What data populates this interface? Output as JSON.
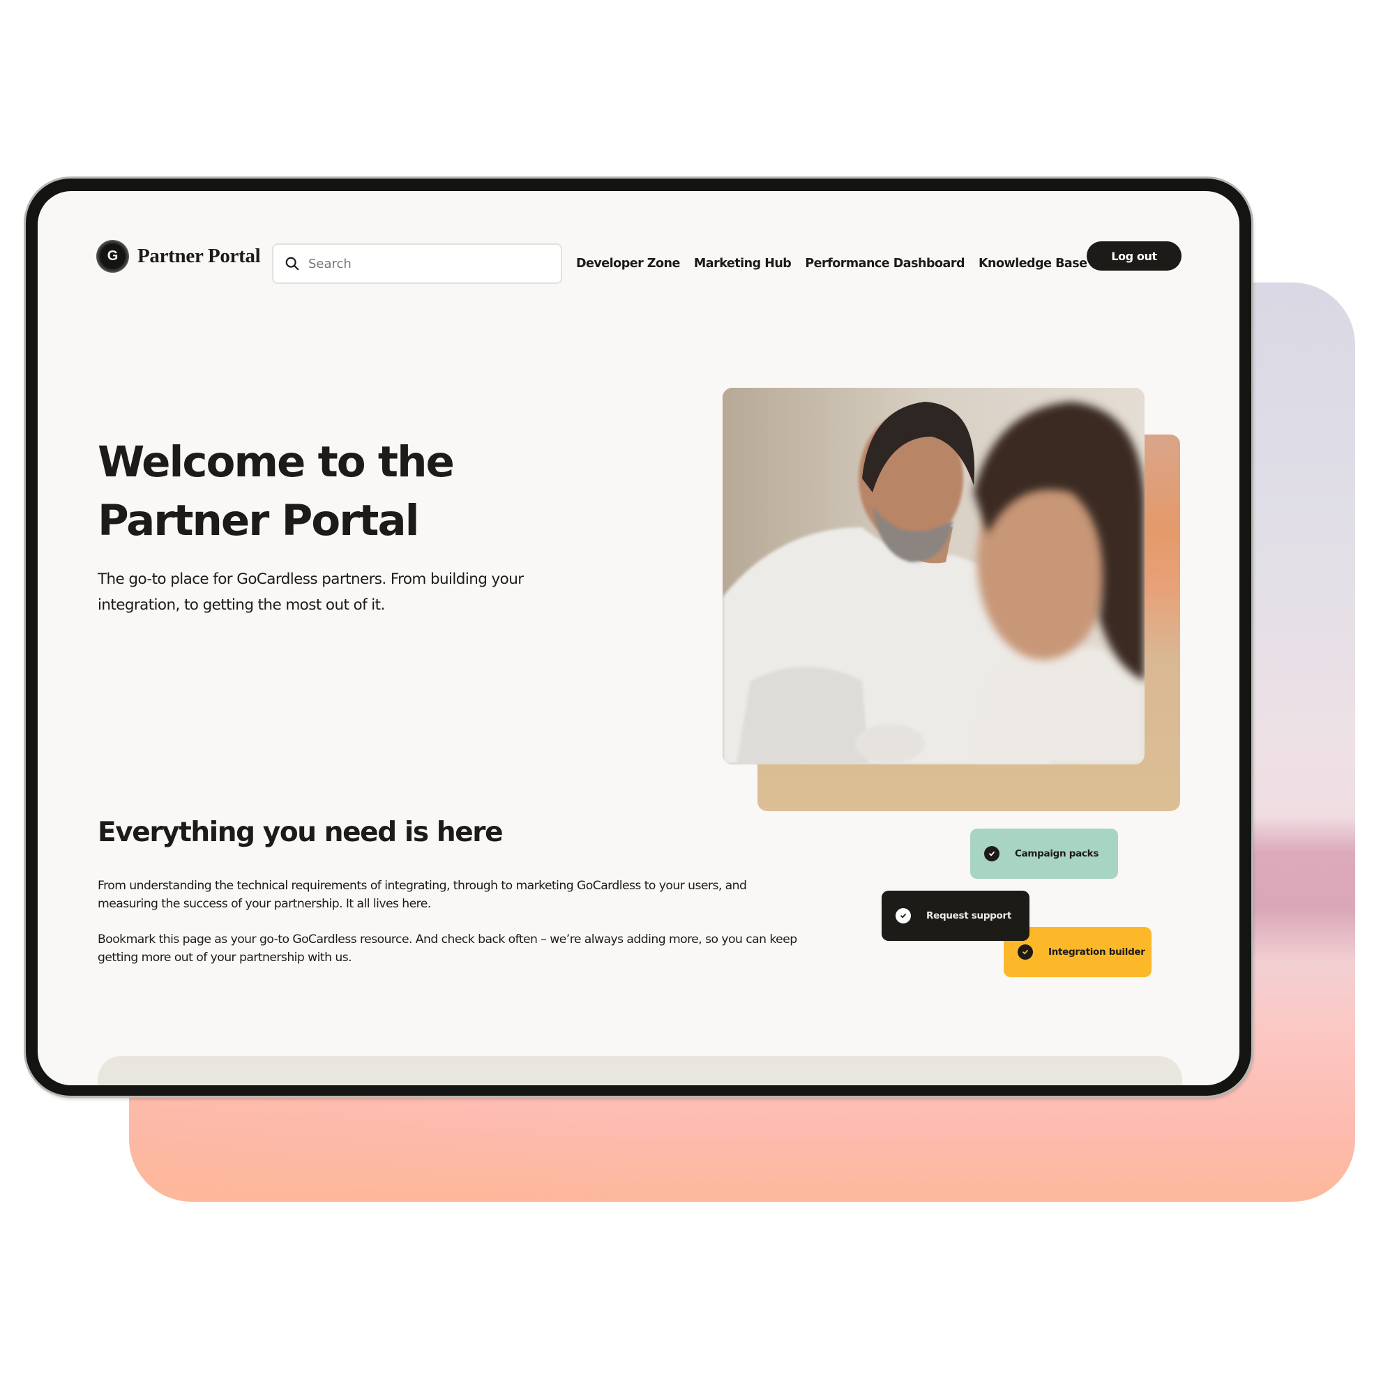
{
  "header": {
    "logo_letter": "G",
    "brand": "Partner Portal",
    "search": {
      "placeholder": "Search",
      "value": ""
    },
    "nav": [
      {
        "label": "Developer Zone"
      },
      {
        "label": "Marketing Hub"
      },
      {
        "label": "Performance Dashboard"
      },
      {
        "label": "Knowledge Base"
      }
    ],
    "logout_label": "Log out"
  },
  "hero": {
    "title_line1": "Welcome to the",
    "title_line2": "Partner Portal",
    "subtitle": "The go-to place for GoCardless partners. From building your integration, to getting the most out of it.",
    "image_alt": "Two colleagues looking at a screen together"
  },
  "features": {
    "title": "Everything you need is here",
    "paragraph1": "From understanding the technical requirements of integrating, through to marketing GoCardless to your users, and measuring the success of your partnership. It all lives here.",
    "paragraph2": "Bookmark this page as your go-to GoCardless resource. And check back often – we’re always adding more, so you can keep getting more out of your partnership with us.",
    "chips": [
      {
        "label": "Campaign packs",
        "icon": "check-circle-icon",
        "color": "#a8d4c4"
      },
      {
        "label": "Request support",
        "icon": "check-circle-icon",
        "color": "#1c1b17"
      },
      {
        "label": "Integration builder",
        "icon": "check-circle-icon",
        "color": "#fdb829"
      }
    ]
  },
  "colors": {
    "page_bg": "#f9f8f6",
    "ink": "#1c1b17",
    "accent_green": "#a8d4c4",
    "accent_yellow": "#fdb829",
    "card_beige": "#e9e5df"
  }
}
